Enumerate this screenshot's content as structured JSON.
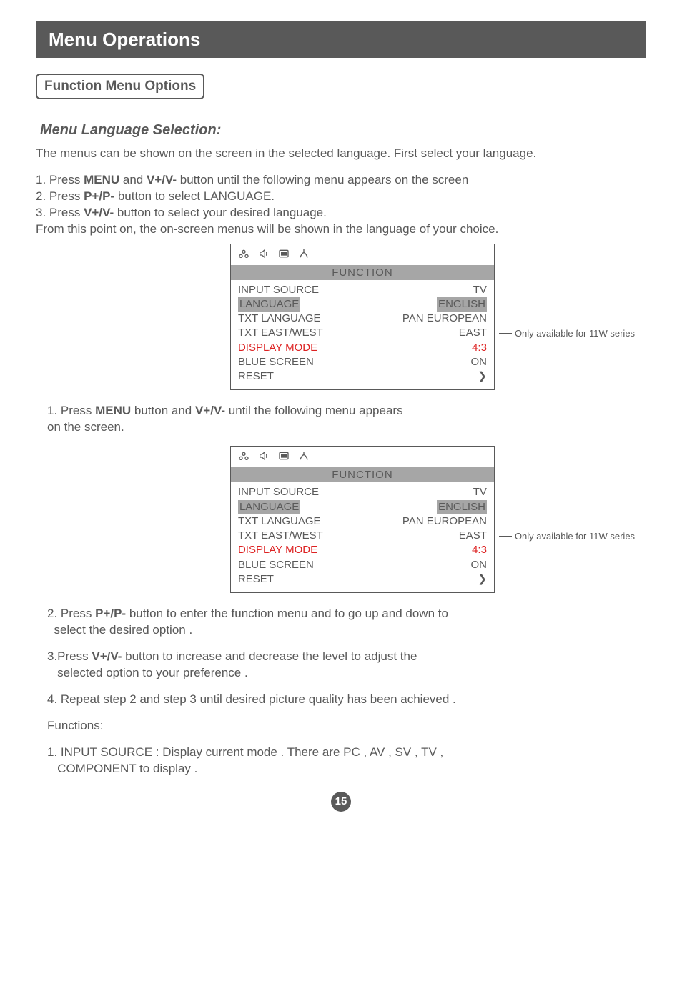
{
  "title": "Menu Operations",
  "subtitle": "Function Menu Options",
  "section_heading": "Menu Language Selection:",
  "intro": "The menus can be shown on the screen in the selected language. First select your language.",
  "steps1": {
    "l1a": "1. Press ",
    "l1b": "MENU",
    "l1c": " and ",
    "l1d": "V+/V-",
    "l1e": " button until the following menu appears on the screen",
    "l2a": "2. Press ",
    "l2b": "P+/P-",
    "l2c": " button to select LANGUAGE.",
    "l3a": "3. Press ",
    "l3b": "V+/V-",
    "l3c": " button to select your desired language.",
    "tail": "From this point on, the on-screen menus will be shown in the language of your choice."
  },
  "osd_header": "FUNCTION",
  "osd1": {
    "rows": [
      {
        "label": "INPUT SOURCE",
        "value": "TV"
      },
      {
        "label": "LANGUAGE",
        "value": "ENGLISH",
        "highlight": true
      },
      {
        "label": "TXT LANGUAGE",
        "value": "PAN EUROPEAN"
      },
      {
        "label": "TXT EAST/WEST",
        "value": "EAST"
      },
      {
        "label": "DISPLAY MODE",
        "value": "4:3",
        "red": true
      },
      {
        "label": "BLUE SCREEN",
        "value": "ON"
      },
      {
        "label": "RESET",
        "value": ""
      }
    ]
  },
  "callout1": "Only available for 11W series",
  "afterosd1_a": "1. Press ",
  "afterosd1_b": "MENU",
  "afterosd1_c": " button and ",
  "afterosd1_d": "V+/V-",
  "afterosd1_e": " until the following menu appears",
  "afterosd1_f": "on the screen.",
  "osd2": {
    "rows": [
      {
        "label": "INPUT SOURCE",
        "value": "TV"
      },
      {
        "label": "LANGUAGE",
        "value": "ENGLISH",
        "highlight": true
      },
      {
        "label": "TXT LANGUAGE",
        "value": "PAN EUROPEAN"
      },
      {
        "label": "TXT EAST/WEST",
        "value": "EAST"
      },
      {
        "label": "DISPLAY MODE",
        "value": "4:3",
        "red": true
      },
      {
        "label": "BLUE SCREEN",
        "value": "ON"
      },
      {
        "label": "RESET",
        "value": ""
      }
    ]
  },
  "callout2": "Only available for 11W series",
  "post_steps": {
    "s2a": "2. Press ",
    "s2b": "P+/P-",
    "s2c": " button to enter the function menu and to go up and down to",
    "s2d": "select the desired option .",
    "s3a": "3.Press ",
    "s3b": "V+/V-",
    "s3c": " button to increase and decrease the level to adjust the",
    "s3d": "selected option to your preference .",
    "s4": "4. Repeat step 2 and step 3 until desired picture quality has been achieved ."
  },
  "functions_heading": "Functions:",
  "func1a": "1. INPUT SOURCE : Display current mode . There are PC , AV , SV , TV ,",
  "func1b": "COMPONENT to display .",
  "page_number": "15",
  "arrow_glyph": "❯"
}
